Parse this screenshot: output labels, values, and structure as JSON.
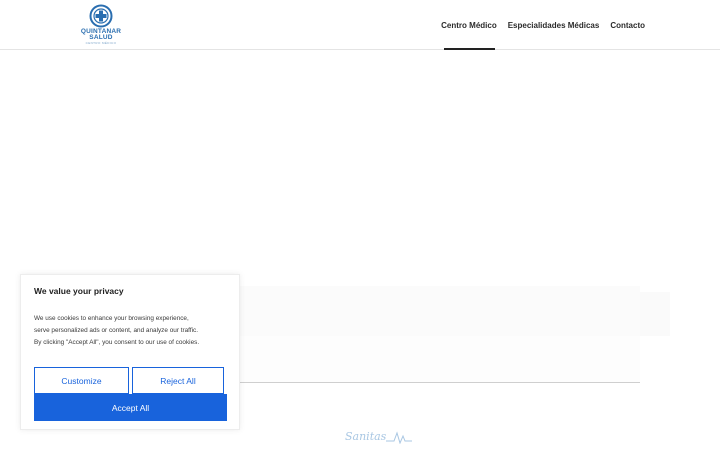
{
  "header": {
    "logo": {
      "line1": "QUINTANAR",
      "line2": "SALUD",
      "tagline": "CENTRO MÉDICO",
      "icon": "cross-in-circle-icon",
      "color": "#2a6eb0"
    },
    "nav": [
      {
        "label": "Centro Médico",
        "active": true
      },
      {
        "label": "Especialidades Médicas",
        "active": false
      },
      {
        "label": "Contacto",
        "active": false
      }
    ]
  },
  "partner": {
    "name": "Sanitas",
    "icon": "heartbeat-line-icon",
    "color": "#a9c7e3"
  },
  "cookie_banner": {
    "title": "We value your privacy",
    "body_line1": "We use cookies to enhance your browsing experience,",
    "body_line2": "serve personalized ads or content, and analyze our traffic.",
    "body_line3": "By clicking \"Accept All\", you consent to our use of cookies.",
    "customize_label": "Customize",
    "reject_label": "Reject All",
    "accept_label": "Accept All",
    "accent_color": "#1863dc"
  }
}
